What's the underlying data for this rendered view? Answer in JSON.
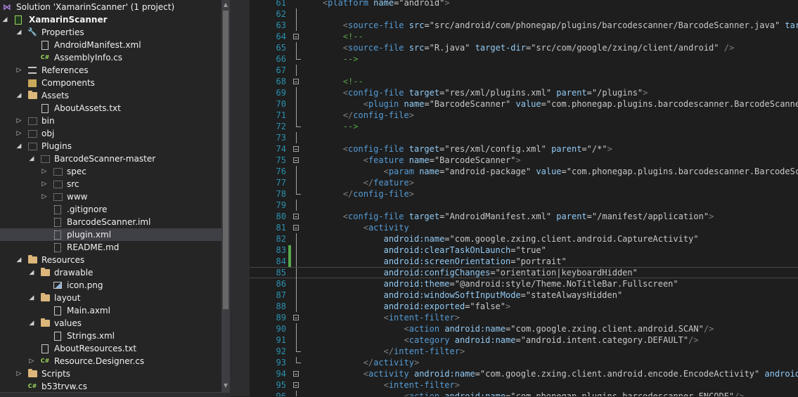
{
  "solution_explorer": {
    "items": [
      {
        "label": "Solution 'XamarinScanner' (1 project)",
        "depth": 0,
        "arrow": "",
        "icon": "solution-icon",
        "bold": false,
        "selected": false
      },
      {
        "label": "XamarinScanner",
        "depth": 0,
        "arrow": "open",
        "icon": "android-project-icon",
        "bold": true,
        "selected": false
      },
      {
        "label": "Properties",
        "depth": 1,
        "arrow": "open",
        "icon": "wrench-icon",
        "bold": false,
        "selected": false
      },
      {
        "label": "AndroidManifest.xml",
        "depth": 2,
        "arrow": "",
        "icon": "xml-file-icon",
        "bold": false,
        "selected": false
      },
      {
        "label": "AssemblyInfo.cs",
        "depth": 2,
        "arrow": "",
        "icon": "csharp-file-icon",
        "bold": false,
        "selected": false
      },
      {
        "label": "References",
        "depth": 1,
        "arrow": "closed",
        "icon": "references-icon",
        "bold": false,
        "selected": false
      },
      {
        "label": "Components",
        "depth": 1,
        "arrow": "",
        "icon": "components-icon",
        "bold": false,
        "selected": false
      },
      {
        "label": "Assets",
        "depth": 1,
        "arrow": "open",
        "icon": "folder-icon",
        "bold": false,
        "selected": false
      },
      {
        "label": "AboutAssets.txt",
        "depth": 2,
        "arrow": "",
        "icon": "text-file-icon",
        "bold": false,
        "selected": false
      },
      {
        "label": "bin",
        "depth": 1,
        "arrow": "closed",
        "icon": "hidden-folder-icon",
        "bold": false,
        "selected": false
      },
      {
        "label": "obj",
        "depth": 1,
        "arrow": "closed",
        "icon": "hidden-folder-icon",
        "bold": false,
        "selected": false
      },
      {
        "label": "Plugins",
        "depth": 1,
        "arrow": "open",
        "icon": "hidden-folder-icon",
        "bold": false,
        "selected": false
      },
      {
        "label": "BarcodeScanner-master",
        "depth": 2,
        "arrow": "open",
        "icon": "hidden-folder-icon",
        "bold": false,
        "selected": false
      },
      {
        "label": "spec",
        "depth": 3,
        "arrow": "closed",
        "icon": "hidden-folder-icon",
        "bold": false,
        "selected": false
      },
      {
        "label": "src",
        "depth": 3,
        "arrow": "closed",
        "icon": "hidden-folder-icon",
        "bold": false,
        "selected": false
      },
      {
        "label": "www",
        "depth": 3,
        "arrow": "closed",
        "icon": "hidden-folder-icon",
        "bold": false,
        "selected": false
      },
      {
        "label": ".gitignore",
        "depth": 3,
        "arrow": "",
        "icon": "hidden-file-icon",
        "bold": false,
        "selected": false
      },
      {
        "label": "BarcodeScanner.iml",
        "depth": 3,
        "arrow": "",
        "icon": "hidden-file-icon",
        "bold": false,
        "selected": false
      },
      {
        "label": "plugin.xml",
        "depth": 3,
        "arrow": "",
        "icon": "hidden-file-icon",
        "bold": false,
        "selected": true
      },
      {
        "label": "README.md",
        "depth": 3,
        "arrow": "",
        "icon": "hidden-file-icon",
        "bold": false,
        "selected": false
      },
      {
        "label": "Resources",
        "depth": 1,
        "arrow": "open",
        "icon": "folder-icon",
        "bold": false,
        "selected": false
      },
      {
        "label": "drawable",
        "depth": 2,
        "arrow": "open",
        "icon": "folder-icon",
        "bold": false,
        "selected": false
      },
      {
        "label": "icon.png",
        "depth": 3,
        "arrow": "",
        "icon": "image-file-icon",
        "bold": false,
        "selected": false
      },
      {
        "label": "layout",
        "depth": 2,
        "arrow": "open",
        "icon": "folder-icon",
        "bold": false,
        "selected": false
      },
      {
        "label": "Main.axml",
        "depth": 3,
        "arrow": "",
        "icon": "text-file-icon",
        "bold": false,
        "selected": false
      },
      {
        "label": "values",
        "depth": 2,
        "arrow": "open",
        "icon": "folder-icon",
        "bold": false,
        "selected": false
      },
      {
        "label": "Strings.xml",
        "depth": 3,
        "arrow": "",
        "icon": "xml-file-icon",
        "bold": false,
        "selected": false
      },
      {
        "label": "AboutResources.txt",
        "depth": 2,
        "arrow": "",
        "icon": "text-file-icon",
        "bold": false,
        "selected": false
      },
      {
        "label": "Resource.Designer.cs",
        "depth": 2,
        "arrow": "closed",
        "icon": "csharp-file-icon",
        "bold": false,
        "selected": false
      },
      {
        "label": "Scripts",
        "depth": 1,
        "arrow": "closed",
        "icon": "folder-icon",
        "bold": false,
        "selected": false
      },
      {
        "label": "b53trvw.cs",
        "depth": 1,
        "arrow": "",
        "icon": "csharp-file-icon",
        "bold": false,
        "selected": false
      }
    ]
  },
  "editor": {
    "current_line": "85",
    "lines": [
      {
        "num": "61",
        "fold": "",
        "changed": false,
        "text": "    <platform name=\"android\">"
      },
      {
        "num": "62",
        "fold": "line",
        "changed": false,
        "text": ""
      },
      {
        "num": "63",
        "fold": "line",
        "changed": false,
        "text": "        <source-file src=\"src/android/com/phonegap/plugins/barcodescanner/BarcodeScanner.java\" target-dir=\"src/com/phonegap/plugins/barcodescanner\" />"
      },
      {
        "num": "64",
        "fold": "box",
        "changed": false,
        "text": "        <!--"
      },
      {
        "num": "65",
        "fold": "line",
        "changed": false,
        "text": "        <source-file src=\"R.java\" target-dir=\"src/com/google/zxing/client/android\" />"
      },
      {
        "num": "66",
        "fold": "end",
        "changed": false,
        "text": "        -->"
      },
      {
        "num": "67",
        "fold": "line",
        "changed": false,
        "text": ""
      },
      {
        "num": "68",
        "fold": "box",
        "changed": false,
        "text": "        <!--"
      },
      {
        "num": "69",
        "fold": "line",
        "changed": false,
        "text": "        <config-file target=\"res/xml/plugins.xml\" parent=\"/plugins\">"
      },
      {
        "num": "70",
        "fold": "line",
        "changed": false,
        "text": "            <plugin name=\"BarcodeScanner\" value=\"com.phonegap.plugins.barcodescanner.BarcodeScanner\"/>"
      },
      {
        "num": "71",
        "fold": "line",
        "changed": false,
        "text": "        </config-file>"
      },
      {
        "num": "72",
        "fold": "end",
        "changed": false,
        "text": "        -->"
      },
      {
        "num": "73",
        "fold": "line",
        "changed": false,
        "text": ""
      },
      {
        "num": "74",
        "fold": "box",
        "changed": false,
        "text": "        <config-file target=\"res/xml/config.xml\" parent=\"/*\">"
      },
      {
        "num": "75",
        "fold": "box",
        "changed": false,
        "text": "            <feature name=\"BarcodeScanner\">"
      },
      {
        "num": "76",
        "fold": "line",
        "changed": false,
        "text": "                <param name=\"android-package\" value=\"com.phonegap.plugins.barcodescanner.BarcodeScanner\" />"
      },
      {
        "num": "77",
        "fold": "line",
        "changed": false,
        "text": "            </feature>"
      },
      {
        "num": "78",
        "fold": "end",
        "changed": false,
        "text": "        </config-file>"
      },
      {
        "num": "79",
        "fold": "line",
        "changed": false,
        "text": ""
      },
      {
        "num": "80",
        "fold": "box",
        "changed": false,
        "text": "        <config-file target=\"AndroidManifest.xml\" parent=\"/manifest/application\">"
      },
      {
        "num": "81",
        "fold": "box",
        "changed": false,
        "text": "            <activity"
      },
      {
        "num": "82",
        "fold": "line",
        "changed": false,
        "text": "                android:name=\"com.google.zxing.client.android.CaptureActivity\""
      },
      {
        "num": "83",
        "fold": "line",
        "changed": true,
        "text": "                android:clearTaskOnLaunch=\"true\""
      },
      {
        "num": "84",
        "fold": "line",
        "changed": true,
        "text": "                android:screenOrientation=\"portrait\""
      },
      {
        "num": "85",
        "fold": "line",
        "changed": false,
        "text": "                android:configChanges=\"orientation|keyboardHidden\""
      },
      {
        "num": "86",
        "fold": "line",
        "changed": false,
        "text": "                android:theme=\"@android:style/Theme.NoTitleBar.Fullscreen\""
      },
      {
        "num": "87",
        "fold": "line",
        "changed": false,
        "text": "                android:windowSoftInputMode=\"stateAlwaysHidden\""
      },
      {
        "num": "88",
        "fold": "line",
        "changed": false,
        "text": "                android:exported=\"false\">"
      },
      {
        "num": "89",
        "fold": "box",
        "changed": false,
        "text": "                <intent-filter>"
      },
      {
        "num": "90",
        "fold": "line",
        "changed": false,
        "text": "                    <action android:name=\"com.google.zxing.client.android.SCAN\"/>"
      },
      {
        "num": "91",
        "fold": "line",
        "changed": false,
        "text": "                    <category android:name=\"android.intent.category.DEFAULT\"/>"
      },
      {
        "num": "92",
        "fold": "end",
        "changed": false,
        "text": "                </intent-filter>"
      },
      {
        "num": "93",
        "fold": "end",
        "changed": false,
        "text": "            </activity>"
      },
      {
        "num": "94",
        "fold": "box",
        "changed": false,
        "text": "            <activity android:name=\"com.google.zxing.client.android.encode.EncodeActivity\" android:label=\"Share\">"
      },
      {
        "num": "95",
        "fold": "box",
        "changed": false,
        "text": "                <intent-filter>"
      },
      {
        "num": "96",
        "fold": "line",
        "changed": false,
        "text": "                    <action android:name=\"com.phonegap.plugins.barcodescanner.ENCODE\"/>"
      }
    ]
  }
}
